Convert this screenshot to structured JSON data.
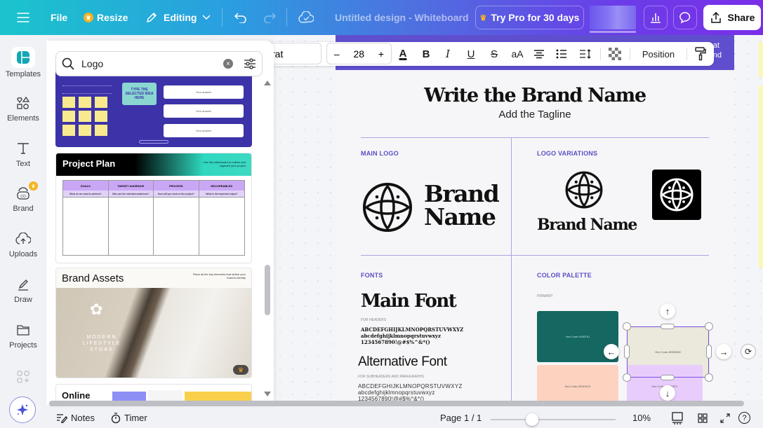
{
  "topbar": {
    "menu_icon": "hamburger-icon",
    "file_label": "File",
    "resize_label": "Resize",
    "editing_label": "Editing",
    "design_title": "Untitled design - Whiteboard",
    "pro_label": "Try Pro for 30 days",
    "share_label": "Share"
  },
  "rail": {
    "items": [
      {
        "label": "Templates",
        "icon": "templates-icon"
      },
      {
        "label": "Elements",
        "icon": "elements-icon"
      },
      {
        "label": "Text",
        "icon": "text-icon"
      },
      {
        "label": "Brand",
        "icon": "brand-icon"
      },
      {
        "label": "Uploads",
        "icon": "uploads-icon"
      },
      {
        "label": "Draw",
        "icon": "draw-icon"
      },
      {
        "label": "Projects",
        "icon": "projects-icon"
      }
    ]
  },
  "panel": {
    "search_value": "Logo",
    "templates": [
      {
        "title": "",
        "box_text": "TYPE THE SELECTED IDEA HERE",
        "answer_label": "Your answer"
      },
      {
        "title": "Project Plan",
        "subtitle": "Use this whiteboard to outline and organize your project",
        "columns": [
          "GOALS",
          "TARGET AUDIENCE",
          "PROCESS",
          "DELIVERABLES"
        ],
        "questions": [
          "What do we want to achieve?",
          "Who are the intended audiences?",
          "How will you work on the project?",
          "What is the expected output?"
        ]
      },
      {
        "title": "Brand Assets",
        "subtitle": "Place all the key elements that define your brand's identity",
        "image_text": "MODERN LIFESTYLE STORE"
      },
      {
        "title": "Online"
      }
    ]
  },
  "toolbar": {
    "font_name": "rat",
    "font_size": "28",
    "minus": "–",
    "plus": "+",
    "position_label": "Position"
  },
  "page": {
    "header_right": "at\nnd",
    "brand_title": "Write the Brand Name",
    "tagline": "Add the Tagline",
    "main_logo_label": "MAIN LOGO",
    "logo_variations_label": "LOGO VARIATIONS",
    "brand_word1": "Brand",
    "brand_word2": "Name",
    "brand_inline": "Brand Name",
    "fonts_label": "FONTS",
    "main_font": "Main Font",
    "for_headers": "FOR HEADERS",
    "upper": "ABCDEFGHIJKLMNOPQRSTUVWXYZ",
    "lower": "abcdefghijklmnopqrstuvwxyz",
    "digits": "1234567890!@#$%^&*()",
    "alt_font": "Alternative Font",
    "for_sub": "FOR SUBHEADERS AND PARAGRAPHS",
    "color_palette_label": "COLOR PALETTE",
    "primary_label": "PRIMARY",
    "swatches": [
      {
        "color": "#156761",
        "text": "Hex Code #156761"
      },
      {
        "color": "#ebe8dc",
        "text": "Hex Code #EBE8DC"
      },
      {
        "color": "#fdd3c0",
        "text": "Hex Code #FDD3C0"
      },
      {
        "color": "#e8cdfc",
        "text": "Hex Code #E8CDFC"
      }
    ]
  },
  "bottombar": {
    "notes_label": "Notes",
    "timer_label": "Timer",
    "page_label": "Page 1 / 1",
    "zoom_label": "10%",
    "zoom_fraction": 0.33
  }
}
